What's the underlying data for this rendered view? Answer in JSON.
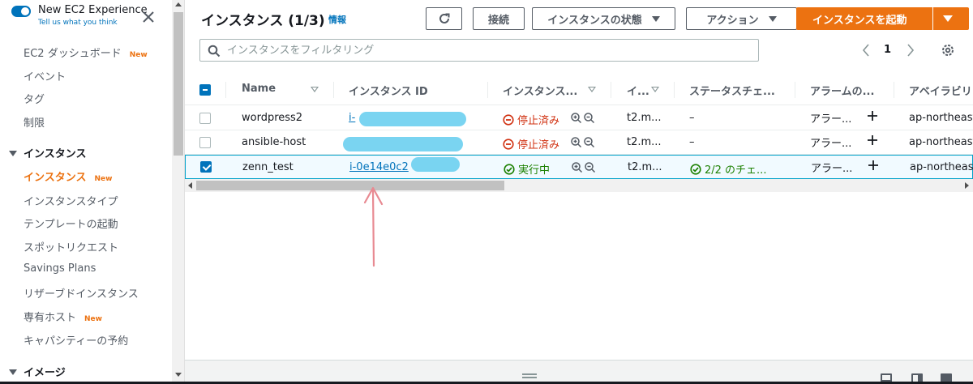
{
  "sidebar": {
    "toggle_title": "New EC2 Experience",
    "toggle_subtitle": "Tell us what you think",
    "dashboard": "EC2 ダッシュボード",
    "new_badge": "New",
    "events": "イベント",
    "tags": "タグ",
    "limits": "制限",
    "section_instances": "インスタンス",
    "instances": "インスタンス",
    "instance_types": "インスタンスタイプ",
    "launch_templates": "テンプレートの起動",
    "spot_requests": "スポットリクエスト",
    "savings_plans": "Savings Plans",
    "reserved_instances": "リザーブドインスタンス",
    "dedicated_hosts": "専有ホスト",
    "capacity_reservations": "キャパシティーの予約",
    "section_images": "イメージ"
  },
  "header": {
    "title": "インスタンス (1/3)",
    "info": "情報",
    "connect": "接続",
    "instance_state": "インスタンスの状態",
    "actions": "アクション",
    "launch": "インスタンスを起動"
  },
  "search": {
    "placeholder": "インスタンスをフィルタリング",
    "value": ""
  },
  "pagination": {
    "page": "1"
  },
  "table": {
    "columns": {
      "name": "Name",
      "instance_id": "インスタンス ID",
      "state": "インスタンス...",
      "type": "イ...",
      "status_check": "ステータスチェ...",
      "alarm": "アラームの...",
      "az": "アベイラビリ"
    },
    "rows": [
      {
        "name": "wordpress2",
        "instance_id": "i-",
        "state": "停止済み",
        "type": "t2.m...",
        "status_check": "–",
        "alarm": "アラー...",
        "az": "ap-northeast",
        "selected": false
      },
      {
        "name": "ansible-host",
        "instance_id": "",
        "state": "停止済み",
        "type": "t2.m...",
        "status_check": "–",
        "alarm": "アラー...",
        "az": "ap-northeast",
        "selected": false
      },
      {
        "name": "zenn_test",
        "instance_id": "i-0e14e0c2",
        "state": "実行中",
        "type": "t2.m...",
        "status_check": "2/2 のチェ...",
        "alarm": "アラー...",
        "az": "ap-northeast",
        "selected": true
      }
    ]
  },
  "colors": {
    "accent": "#ec7211",
    "link": "#0073bb",
    "stopped": "#d13212",
    "running": "#1d8102",
    "annotation": "#e88a92"
  }
}
